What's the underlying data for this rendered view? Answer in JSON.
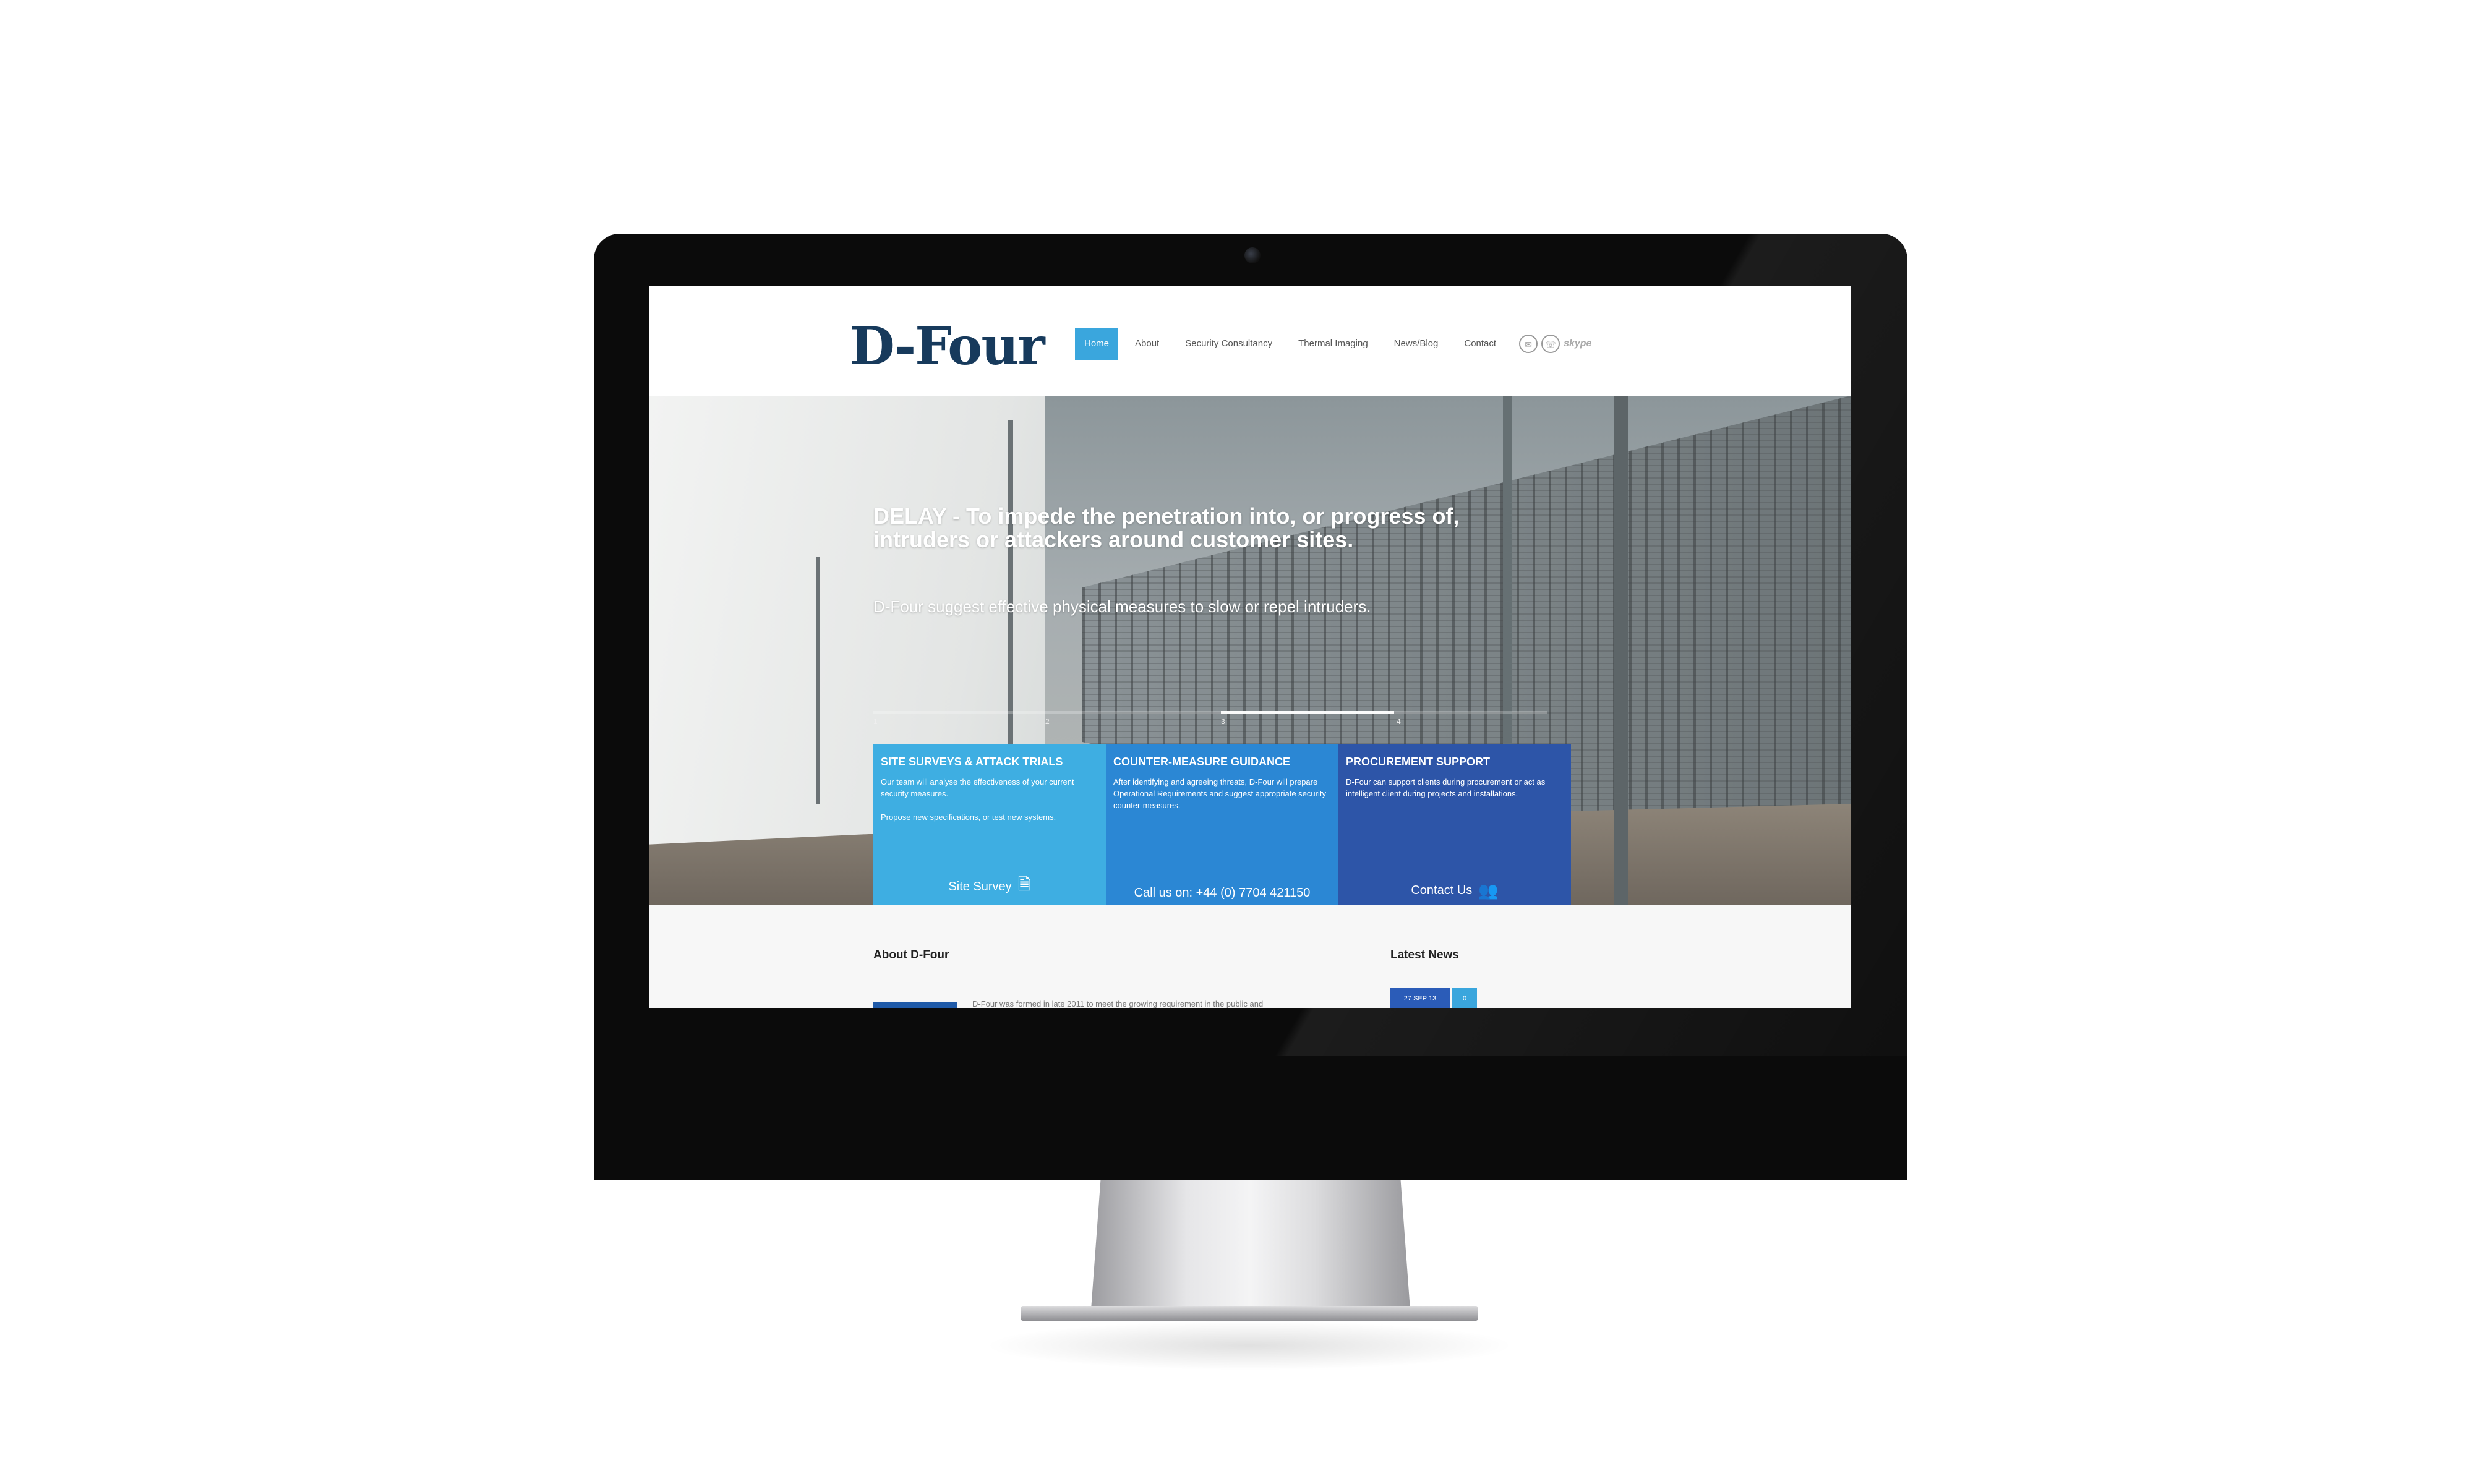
{
  "site": {
    "logo": "D-Four"
  },
  "nav": {
    "items": [
      {
        "label": "Home",
        "active": true
      },
      {
        "label": "About",
        "active": false
      },
      {
        "label": "Security Consultancy",
        "active": false
      },
      {
        "label": "Thermal Imaging",
        "active": false
      },
      {
        "label": "News/Blog",
        "active": false
      },
      {
        "label": "Contact",
        "active": false
      }
    ],
    "social_icons": [
      "email-icon",
      "phone-icon",
      "skype-icon"
    ],
    "skype_label": "skype"
  },
  "hero": {
    "title": "DELAY - To impede the penetration into, or progress of, intruders or attackers around customer sites.",
    "subtitle": "D-Four suggest effective physical measures to slow or repel intruders.",
    "slides": [
      "1",
      "2",
      "3",
      "4"
    ],
    "active_slide": 3
  },
  "services": [
    {
      "title": "SITE SURVEYS & ATTACK TRIALS",
      "text": "Our team will analyse the effectiveness of your current security measures.\n\nPropose new specifications, or test new systems.",
      "cta": "Site Survey",
      "cta_icon": "document-icon",
      "color": "#3eaee2"
    },
    {
      "title": "COUNTER-MEASURE GUIDANCE",
      "text": "After identifying and agreeing threats, D-Four will prepare Operational Requirements and suggest appropriate security counter-measures.",
      "cta": "Call us on: +44 (0) 7704 421150",
      "cta_icon": "",
      "color": "#2b87d4"
    },
    {
      "title": "PROCUREMENT SUPPORT",
      "text": "D-Four can support clients during procurement or act as intelligent client during projects and installations.",
      "cta": "Contact Us",
      "cta_icon": "users-icon",
      "color": "#2d55a8"
    }
  ],
  "about": {
    "heading": "About D-Four",
    "text": "D-Four was formed in late 2011 to meet the growing requirement in the public and"
  },
  "news": {
    "heading": "Latest News",
    "date": "27 SEP 13",
    "count": "0"
  },
  "colors": {
    "accent": "#3aa6dd",
    "logo": "#173a5c"
  }
}
